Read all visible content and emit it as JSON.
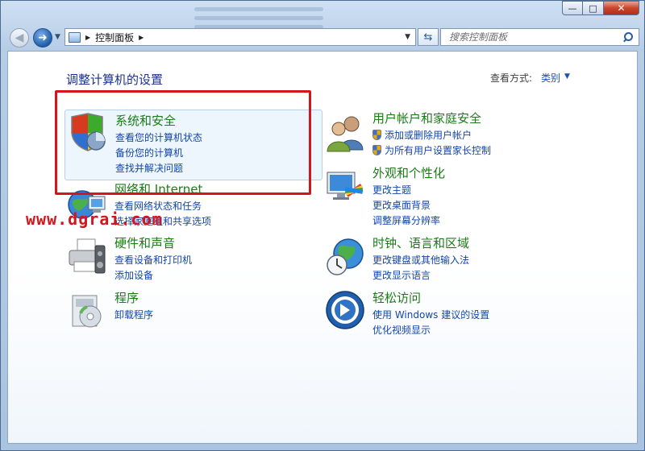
{
  "window": {
    "controls": {
      "minimize": "—",
      "maximize": "□",
      "close": "✕"
    }
  },
  "nav": {
    "address_path": "控制面板",
    "search_placeholder": "搜索控制面板"
  },
  "header": {
    "title": "调整计算机的设置",
    "view_by_label": "查看方式:",
    "view_by_value": "类别"
  },
  "categories": [
    {
      "title": "系统和安全",
      "links": [
        "查看您的计算机状态",
        "备份您的计算机",
        "查找并解决问题"
      ]
    },
    {
      "title": "网络和 Internet",
      "links": [
        "查看网络状态和任务",
        "选择家庭组和共享选项"
      ]
    },
    {
      "title": "硬件和声音",
      "links": [
        "查看设备和打印机",
        "添加设备"
      ]
    },
    {
      "title": "程序",
      "links": [
        "卸载程序"
      ]
    },
    {
      "title": "用户帐户和家庭安全",
      "links": [
        "添加或删除用户帐户",
        "为所有用户设置家长控制"
      ]
    },
    {
      "title": "外观和个性化",
      "links": [
        "更改主题",
        "更改桌面背景",
        "调整屏幕分辨率"
      ]
    },
    {
      "title": "时钟、语言和区域",
      "links": [
        "更改键盘或其他输入法",
        "更改显示语言"
      ]
    },
    {
      "title": "轻松访问",
      "links": [
        "使用 Windows 建议的设置",
        "优化视频显示"
      ]
    }
  ],
  "watermark": "www.dgrai.com",
  "colors": {
    "heading_green": "#1b7b16",
    "link_blue": "#1346a8",
    "title_blue": "#1e3287",
    "highlight_red": "#d6141c"
  }
}
